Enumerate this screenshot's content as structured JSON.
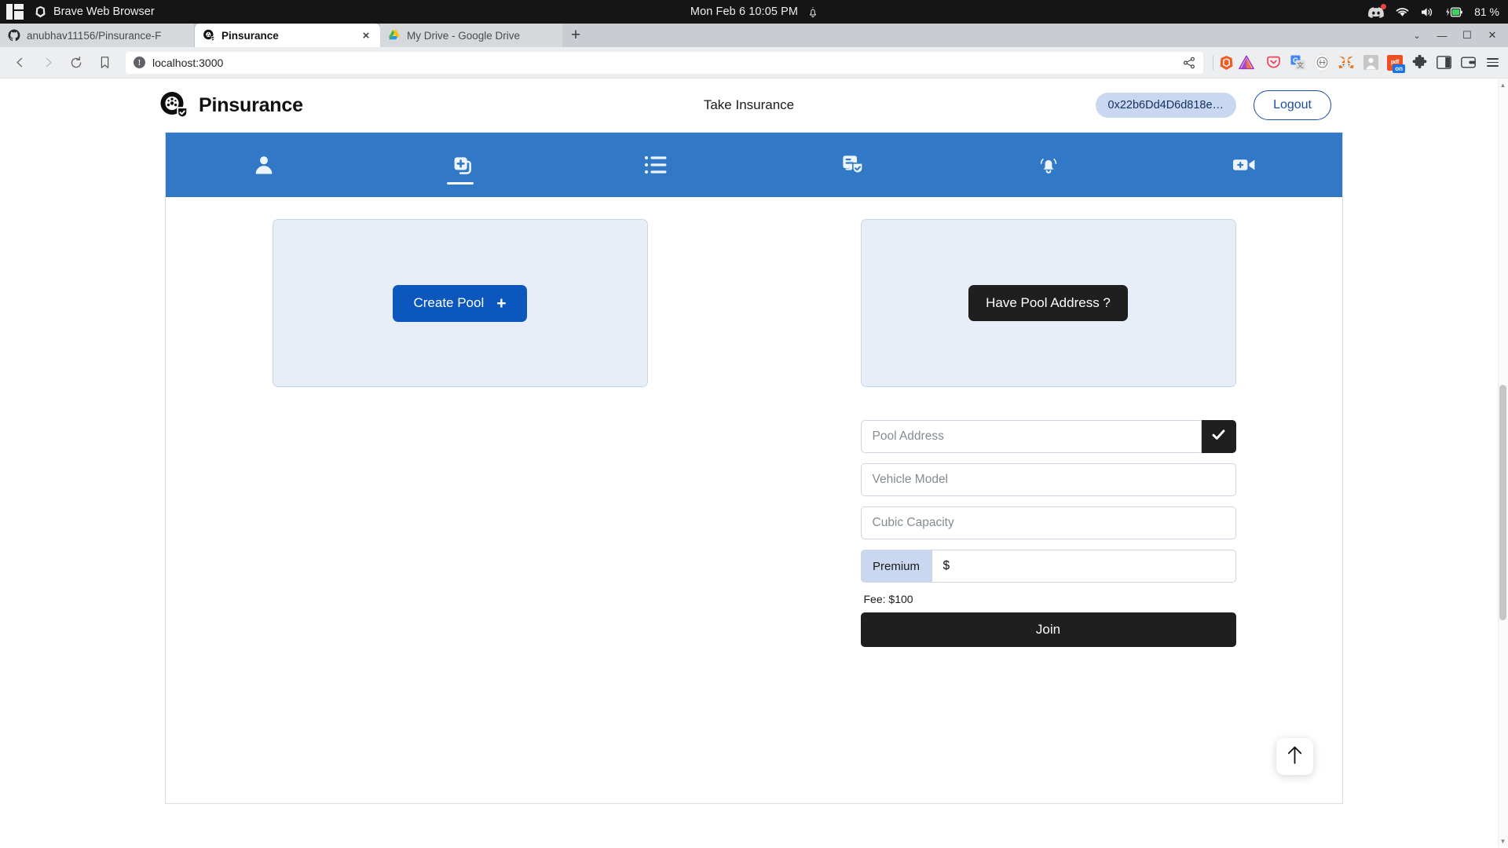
{
  "os_bar": {
    "apps_icon": "apps-grid-icon",
    "active_app": "Brave Web Browser",
    "clock": "Mon Feb 6  10:05 PM",
    "notification_icon": "bell-icon",
    "tray": {
      "discord_icon": "discord-icon",
      "wifi_icon": "wifi-icon",
      "volume_icon": "volume-icon",
      "battery_icon": "battery-charging-icon",
      "battery_level": "81 %"
    }
  },
  "browser": {
    "tabs": [
      {
        "title": "anubhav11156/Pinsurance-F",
        "favicon": "github-icon",
        "active": false
      },
      {
        "title": "Pinsurance",
        "favicon": "pinsurance-icon",
        "active": true,
        "close": "×"
      },
      {
        "title": "My Drive - Google Drive",
        "favicon": "google-drive-icon",
        "active": false
      }
    ],
    "new_tab_label": "+",
    "window_controls": {
      "list": "⌄",
      "minimize": "—",
      "maximize": "☐",
      "close": "✕"
    },
    "toolbar": {
      "back_icon": "back-arrow-icon",
      "forward_icon": "forward-arrow-icon",
      "reload_icon": "reload-icon",
      "bookmark_icon": "bookmark-icon",
      "url": "localhost:3000",
      "url_security_icon": "not-secure-icon",
      "share_icon": "share-icon",
      "brave_shield_icon": "brave-shields-icon",
      "bat_rewards_icon": "brave-rewards-icon",
      "extensions": [
        "pocket-icon",
        "google-translate-icon",
        "circle-extension-icon",
        "metamask-fox-icon",
        "avatar-extension-icon",
        "pdf-extension-icon",
        "puzzle-extensions-icon",
        "sidebar-icon",
        "brave-wallet-icon",
        "menu-hamburger-icon"
      ],
      "pdf_badge": "on",
      "pdf_label": "pdf"
    }
  },
  "app": {
    "brand": {
      "name": "Pinsurance",
      "logo_icon": "pinsurance-logo-icon"
    },
    "page_title": "Take Insurance",
    "wallet_address": "0x22b6Dd4D6d818e…",
    "logout_label": "Logout",
    "nav_items": [
      {
        "icon": "user-profile-icon",
        "active": false
      },
      {
        "icon": "add-policy-icon",
        "active": true
      },
      {
        "icon": "list-icon",
        "active": false
      },
      {
        "icon": "document-verified-icon",
        "active": false
      },
      {
        "icon": "bell-notification-icon",
        "active": false
      },
      {
        "icon": "video-add-icon",
        "active": false
      }
    ],
    "left_pane": {
      "create_pool_label": "Create Pool",
      "plus_icon": "plus-icon"
    },
    "right_pane": {
      "have_pool_address_label": "Have Pool Address ?",
      "fields": [
        {
          "name": "pool-address",
          "placeholder": "Pool Address",
          "value": "",
          "has_check_button": true,
          "check_icon": "check-icon"
        },
        {
          "name": "vehicle-model",
          "placeholder": "Vehicle Model",
          "value": "",
          "has_check_button": false
        },
        {
          "name": "cubic-capacity",
          "placeholder": "Cubic Capacity",
          "value": "",
          "has_check_button": false
        }
      ],
      "premium": {
        "label": "Premium",
        "value": "$"
      },
      "fee_text": "Fee: $100",
      "join_label": "Join"
    },
    "scroll_top_icon": "arrow-up-icon"
  },
  "colors": {
    "nav_blue": "#3178c6",
    "primary_blue": "#0b57be",
    "dark": "#1f1f1f",
    "card_bg": "#e8eef7",
    "chip_bg": "#c9d8f0"
  }
}
